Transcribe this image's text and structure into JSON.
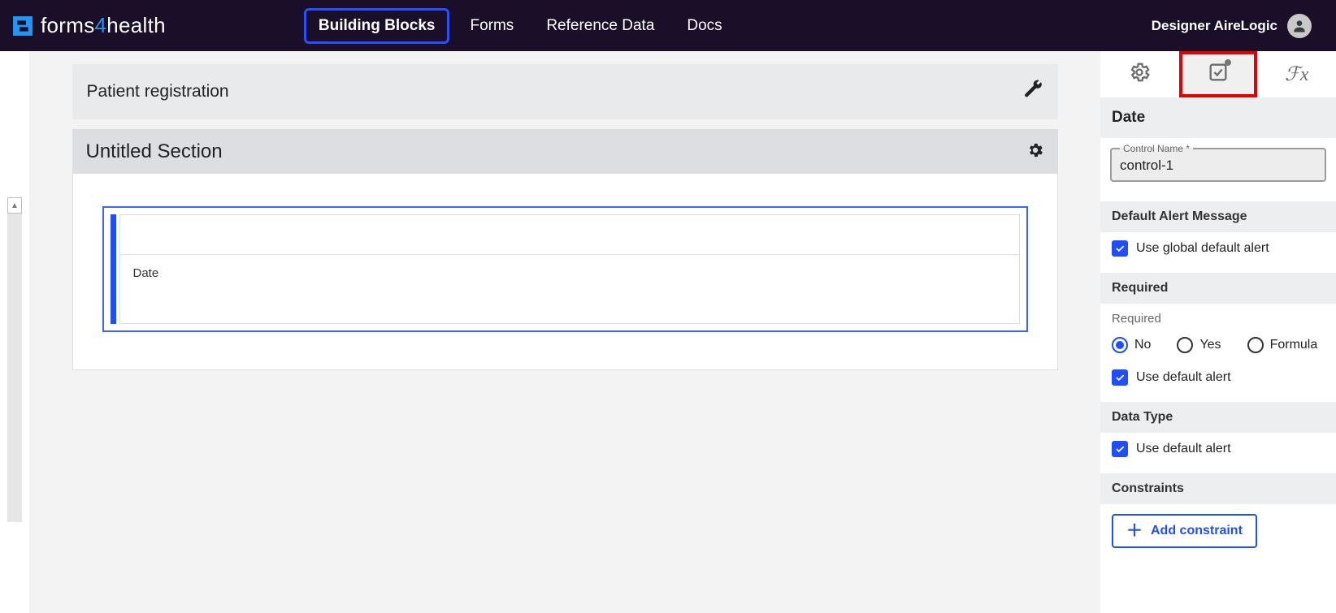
{
  "brand": {
    "prefix": "forms",
    "blue": "4",
    "suffix": "health"
  },
  "nav": {
    "items": [
      {
        "label": "Building Blocks",
        "active": true
      },
      {
        "label": "Forms"
      },
      {
        "label": "Reference Data"
      },
      {
        "label": "Docs"
      }
    ]
  },
  "user": {
    "name": "Designer AireLogic"
  },
  "form": {
    "title": "Patient registration",
    "section_title": "Untitled Section",
    "control_label": "Date"
  },
  "panel": {
    "title": "Date",
    "control_name_label": "Control Name *",
    "control_name_value": "control-1",
    "default_alert_header": "Default Alert Message",
    "use_global_default_alert": "Use global default alert",
    "required_header": "Required",
    "required_label": "Required",
    "required_options": {
      "no": "No",
      "yes": "Yes",
      "formula": "Formula"
    },
    "use_default_alert": "Use default alert",
    "data_type_header": "Data Type",
    "constraints_header": "Constraints",
    "add_constraint": "Add constraint"
  }
}
